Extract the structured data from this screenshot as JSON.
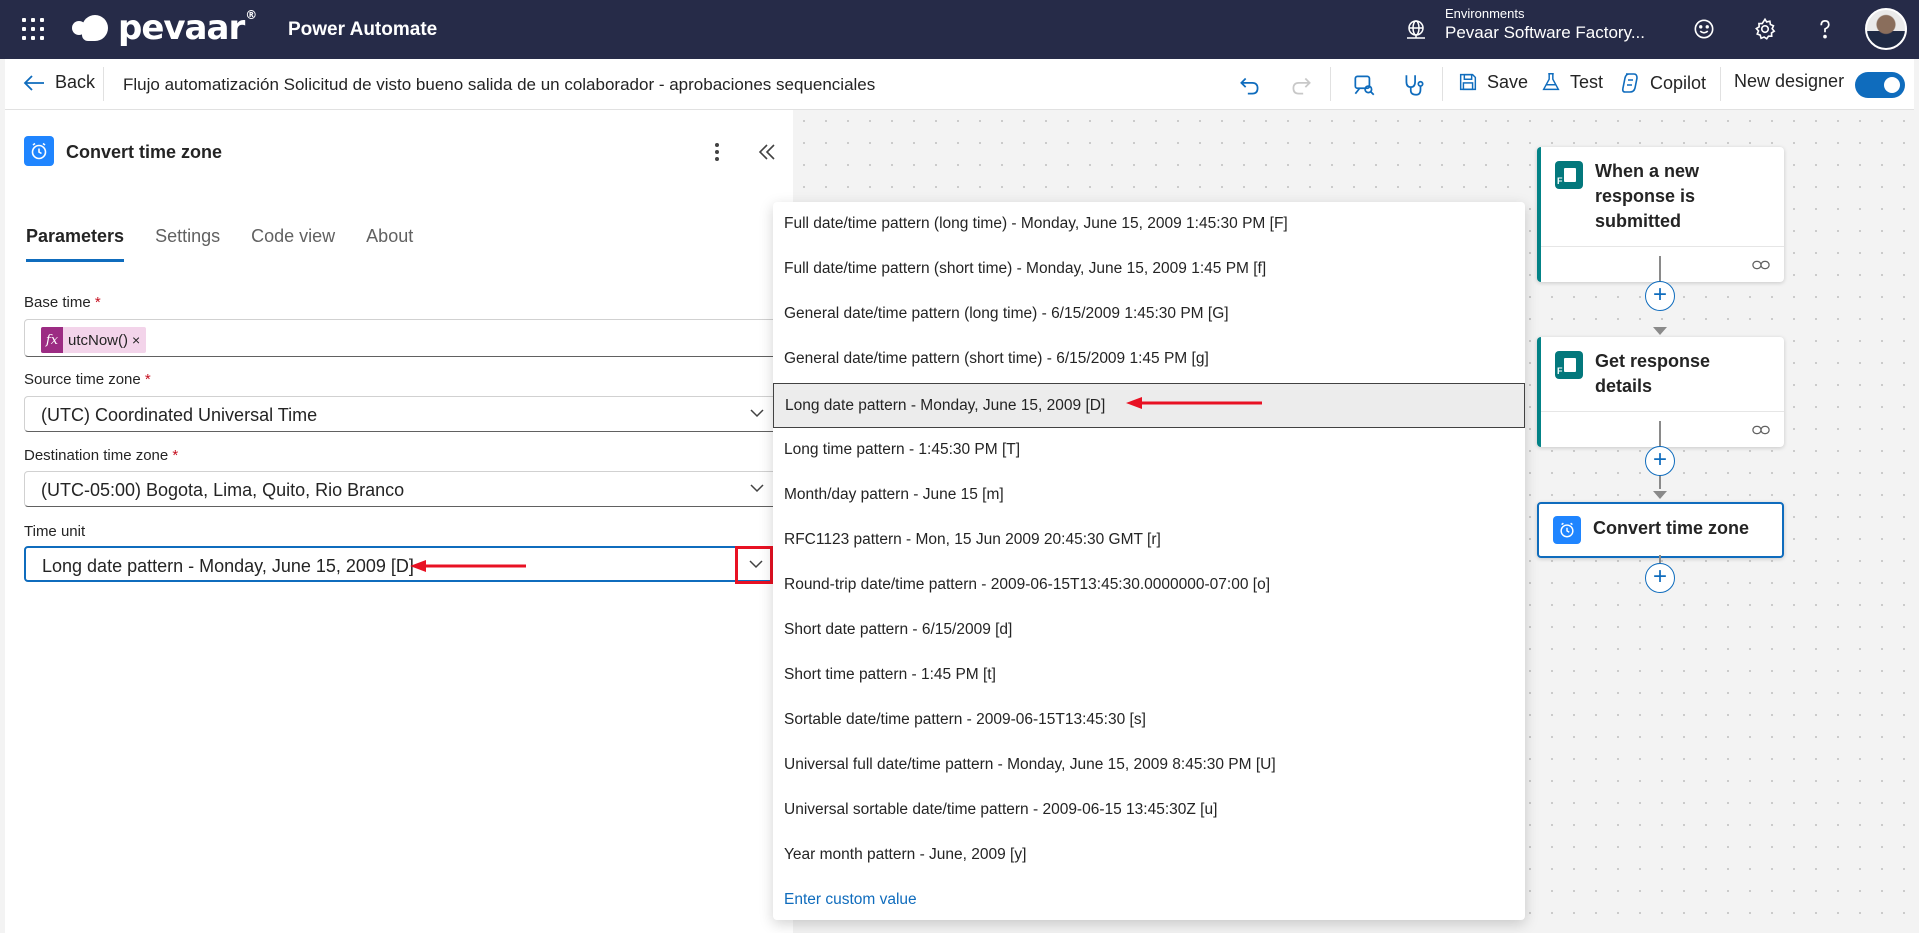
{
  "topbar": {
    "brand": "pevaar",
    "brand_mark": "®",
    "app_name": "Power Automate",
    "env_label": "Environments",
    "env_name": "Pevaar Software Factory...",
    "icons": [
      "waffle-icon",
      "environment-icon",
      "smiley-icon",
      "gear-icon",
      "help-icon",
      "avatar"
    ]
  },
  "cmdbar": {
    "back_label": "Back",
    "flow_title": "Flujo automatización Solicitud de visto bueno salida de un colaborador - aprobaciones sequenciales",
    "save_label": "Save",
    "test_label": "Test",
    "copilot_label": "Copilot",
    "new_designer_label": "New designer",
    "new_designer_on": true
  },
  "panel": {
    "title": "Convert time zone",
    "tabs": [
      {
        "label": "Parameters",
        "active": true
      },
      {
        "label": "Settings",
        "active": false
      },
      {
        "label": "Code view",
        "active": false
      },
      {
        "label": "About",
        "active": false
      }
    ],
    "fields": {
      "base_time_label": "Base time",
      "base_time_token": "utcNow()",
      "base_time_token_fx": "fx",
      "base_time_token_x": "×",
      "source_tz_label": "Source time zone",
      "source_tz_value": "(UTC) Coordinated Universal Time",
      "dest_tz_label": "Destination time zone",
      "dest_tz_value": "(UTC-05:00) Bogota, Lima, Quito, Rio Branco",
      "time_unit_label": "Time unit",
      "time_unit_value": "Long date pattern - Monday, June 15, 2009 [D]",
      "required_mark": "*"
    }
  },
  "dropdown": {
    "options": [
      "Full date/time pattern (long time) - Monday, June 15, 2009 1:45:30 PM [F]",
      "Full date/time pattern (short time) - Monday, June 15, 2009 1:45 PM [f]",
      "General date/time pattern (long time) - 6/15/2009 1:45:30 PM [G]",
      "General date/time pattern (short time) - 6/15/2009 1:45 PM [g]",
      "Long date pattern - Monday, June 15, 2009 [D]",
      "Long time pattern - 1:45:30 PM [T]",
      "Month/day pattern - June 15 [m]",
      "RFC1123 pattern - Mon, 15 Jun 2009 20:45:30 GMT [r]",
      "Round-trip date/time pattern - 2009-06-15T13:45:30.0000000-07:00 [o]",
      "Short date pattern - 6/15/2009 [d]",
      "Short time pattern - 1:45 PM [t]",
      "Sortable date/time pattern - 2009-06-15T13:45:30 [s]",
      "Universal full date/time pattern - Monday, June 15, 2009 8:45:30 PM [U]",
      "Universal sortable date/time pattern - 2009-06-15 13:45:30Z [u]",
      "Year month pattern - June, 2009 [y]"
    ],
    "selected_index": 4,
    "custom_label": "Enter custom value"
  },
  "flow": {
    "cards": [
      {
        "title": "When a new response is submitted",
        "icon": "forms-icon"
      },
      {
        "title": "Get response details",
        "icon": "forms-icon"
      },
      {
        "title": "Convert time zone",
        "icon": "clock-icon"
      }
    ]
  },
  "colors": {
    "topbar": "#262b48",
    "accent": "#0f6cbd",
    "annotation_red": "#e81123",
    "forms_teal": "#03787c",
    "token_purple": "#9c2c83"
  }
}
